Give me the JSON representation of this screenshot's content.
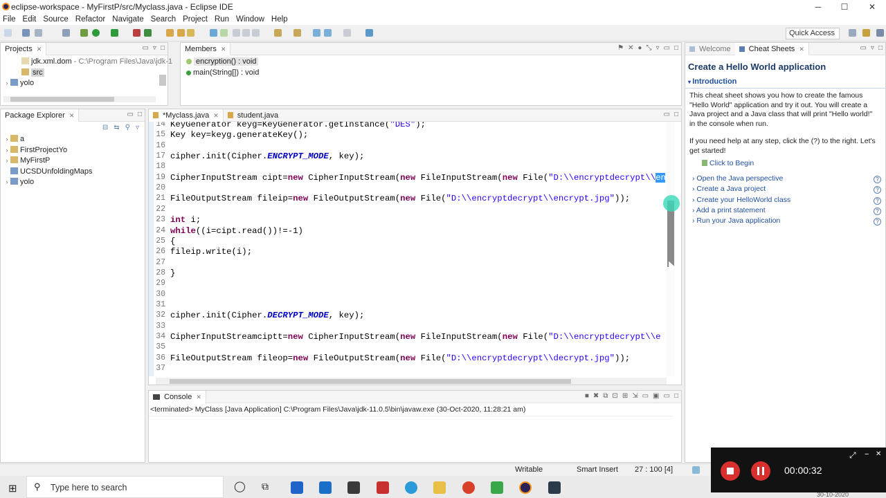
{
  "window": {
    "title": "eclipse-workspace - MyFirstP/src/Myclass.java - Eclipse IDE",
    "minimize": "─",
    "maximize": "☐",
    "close": "✕"
  },
  "menu": [
    "File",
    "Edit",
    "Source",
    "Refactor",
    "Navigate",
    "Search",
    "Project",
    "Run",
    "Window",
    "Help"
  ],
  "toolbar": {
    "quick_access_placeholder": "Quick Access"
  },
  "projects_view": {
    "tab": "Projects",
    "items": [
      {
        "label": "jdk.xml.dom",
        "hint": "- C:\\Program Files\\Java\\jdk-1"
      },
      {
        "label": "src"
      },
      {
        "label": "yolo"
      }
    ]
  },
  "members_view": {
    "tab": "Members",
    "items": [
      {
        "label": "encryption() : void"
      },
      {
        "label": "main(String[]) : void"
      }
    ]
  },
  "package_explorer": {
    "tab": "Package Explorer",
    "items": [
      "a",
      "FirstProjectYo",
      "MyFirstP",
      "UCSDUnfoldingMaps",
      "yolo"
    ]
  },
  "editor": {
    "tabs": [
      "*Myclass.java",
      "student.java"
    ],
    "lines": [
      {
        "n": "14",
        "t": "KeyGenerator keyg=KeyGenerator.getInstance(\"DES\");"
      },
      {
        "n": "15",
        "t": "Key key=keyg.generateKey();"
      },
      {
        "n": "16",
        "t": ""
      },
      {
        "n": "17",
        "t": "cipher.init(Cipher.ENCRYPT_MODE, key);"
      },
      {
        "n": "18",
        "t": ""
      },
      {
        "n": "19",
        "t": "CipherInputStream cipt=new CipherInputStream(new FileInputStream(new File(\"D:\\\\encryptdecrypt\\\\en"
      },
      {
        "n": "20",
        "t": ""
      },
      {
        "n": "21",
        "t": "FileOutputStream fileip=new FileOutputStream(new File(\"D:\\\\encryptdecrypt\\\\encrypt.jpg\"));"
      },
      {
        "n": "22",
        "t": ""
      },
      {
        "n": "23",
        "t": "int i;"
      },
      {
        "n": "24",
        "t": "while((i=cipt.read())!=-1)"
      },
      {
        "n": "25",
        "t": "{"
      },
      {
        "n": "26",
        "t": "fileip.write(i);"
      },
      {
        "n": "27",
        "t": ""
      },
      {
        "n": "28",
        "t": "}"
      },
      {
        "n": "29",
        "t": ""
      },
      {
        "n": "30",
        "t": ""
      },
      {
        "n": "31",
        "t": ""
      },
      {
        "n": "32",
        "t": "cipher.init(Cipher.DECRYPT_MODE, key);"
      },
      {
        "n": "33",
        "t": ""
      },
      {
        "n": "34",
        "t": "CipherInputStreamciptt=new CipherInputStream(new FileInputStream(new File(\"D:\\\\encryptdecrypt\\\\e"
      },
      {
        "n": "35",
        "t": ""
      },
      {
        "n": "36",
        "t": "FileOutputStream fileop=new FileOutputStream(new File(\"D:\\\\encryptdecrypt\\\\decrypt.jpg\"));"
      },
      {
        "n": "37",
        "t": ""
      }
    ]
  },
  "console": {
    "tab": "Console",
    "status": "<terminated> MyClass [Java Application] C:\\Program Files\\Java\\jdk-11.0.5\\bin\\javaw.exe (30-Oct-2020, 11:28:21 am)"
  },
  "cheat_sheet": {
    "tabs": [
      "Welcome",
      "Cheat Sheets"
    ],
    "title": "Create a Hello World application",
    "section": "Introduction",
    "para1": "This cheat sheet shows you how to create the famous \"Hello World\" application and try it out. You will create a Java project and a Java class that will print \"Hello world!\" in the console when run.",
    "para2": "If you need help at any step, click the (?) to the right. Let's get started!",
    "begin": "Click to Begin",
    "steps": [
      "Open the Java perspective",
      "Create a Java project",
      "Create your HelloWorld class",
      "Add a print statement",
      "Run your Java application"
    ]
  },
  "status_bar": {
    "writable": "Writable",
    "insert_mode": "Smart Insert",
    "position": "27 : 100 [4]"
  },
  "taskbar": {
    "search_placeholder": "Type here to search",
    "date_partial": "30-10-2020"
  },
  "recorder": {
    "time": "00:00:32"
  },
  "colors": {
    "keyword": "#7f0055",
    "string": "#2a00ff",
    "constant": "#0000c0",
    "selection": "#3399ff"
  }
}
